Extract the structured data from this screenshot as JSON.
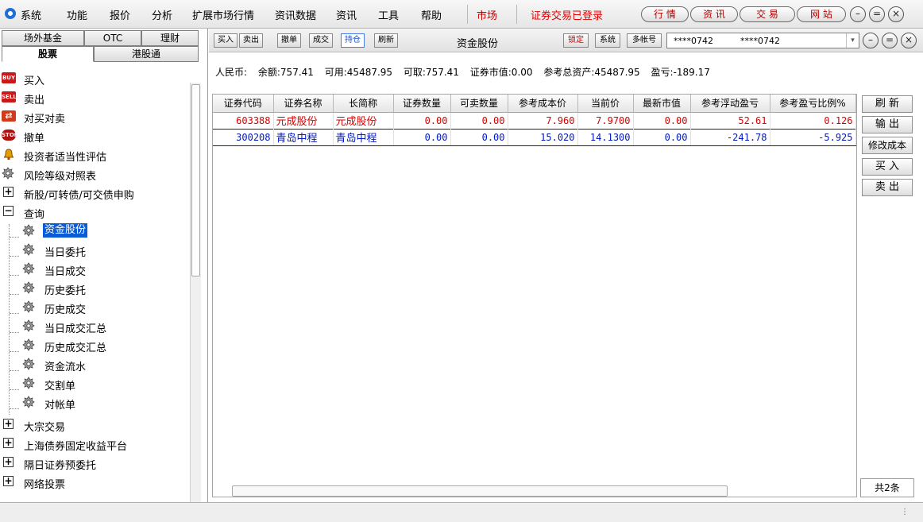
{
  "menu": {
    "items": [
      "系统",
      "功能",
      "报价",
      "分析",
      "扩展市场行情",
      "资讯数据",
      "资讯",
      "工具",
      "帮助"
    ],
    "market": "市场",
    "login_status": "证券交易已登录",
    "pills": [
      "行 情",
      "资 讯",
      "交 易",
      "网 站"
    ],
    "window_controls": [
      "–",
      "=",
      "×"
    ]
  },
  "left": {
    "tabs_row1": [
      "场外基金",
      "OTC",
      "理财"
    ],
    "tabs_row2": [
      "股票",
      "港股通"
    ],
    "tree": [
      {
        "label": "买入",
        "icon": "buy-badge-icon",
        "badge": "BUY"
      },
      {
        "label": "卖出",
        "icon": "sell-badge-icon",
        "badge": "SELL"
      },
      {
        "label": "对买对卖",
        "icon": "swap-icon",
        "badge": "⇄"
      },
      {
        "label": "撤单",
        "icon": "stop-hand-icon",
        "badge": "STOP"
      },
      {
        "label": "投资者适当性评估",
        "icon": "bell-icon"
      },
      {
        "label": "风险等级对照表",
        "icon": "gear-icon"
      },
      {
        "label": "新股/可转债/可交债申购",
        "icon": "plus-box-icon"
      },
      {
        "label": "查询",
        "icon": "minus-box-icon"
      },
      {
        "label": "资金股份",
        "icon": "gear-icon",
        "selected": true
      },
      {
        "label": "当日委托",
        "icon": "gear-icon"
      },
      {
        "label": "当日成交",
        "icon": "gear-icon"
      },
      {
        "label": "历史委托",
        "icon": "gear-icon"
      },
      {
        "label": "历史成交",
        "icon": "gear-icon"
      },
      {
        "label": "当日成交汇总",
        "icon": "gear-icon"
      },
      {
        "label": "历史成交汇总",
        "icon": "gear-icon"
      },
      {
        "label": "资金流水",
        "icon": "gear-icon"
      },
      {
        "label": "交割单",
        "icon": "gear-icon"
      },
      {
        "label": "对帐单",
        "icon": "gear-icon"
      },
      {
        "label": "大宗交易",
        "icon": "plus-box-icon"
      },
      {
        "label": "上海债券固定收益平台",
        "icon": "plus-box-icon"
      },
      {
        "label": "隔日证券预委托",
        "icon": "plus-box-icon"
      },
      {
        "label": "网络投票",
        "icon": "plus-box-icon"
      }
    ]
  },
  "toolbar": {
    "buttons": [
      "买入",
      "卖出",
      "撤单",
      "成交",
      "持仓",
      "刷新"
    ],
    "active_button": "持仓",
    "title": "资金股份",
    "lock": "锁定",
    "system": "系统",
    "multi_account": "多帐号",
    "account_1": "****0742",
    "account_2": "****0742",
    "dropdown_arrow": "▾"
  },
  "summary": {
    "currency": "人民币:",
    "balance": "余额:757.41",
    "available": "可用:45487.95",
    "withdrawable": "可取:757.41",
    "market_value": "证券市值:0.00",
    "total_assets": "参考总资产:45487.95",
    "pnl": "盈亏:-189.17"
  },
  "table": {
    "headers": [
      "证券代码",
      "证券名称",
      "长简称",
      "证券数量",
      "可卖数量",
      "参考成本价",
      "当前价",
      "最新市值",
      "参考浮动盈亏",
      "参考盈亏比例%"
    ],
    "rows": [
      {
        "trend": "up",
        "cells": [
          "603388",
          "元成股份",
          "元成股份",
          "0.00",
          "0.00",
          "7.960",
          "7.9700",
          "0.00",
          "52.61",
          "0.126"
        ]
      },
      {
        "trend": "down",
        "cells": [
          "300208",
          "青岛中程",
          "青岛中程",
          "0.00",
          "0.00",
          "15.020",
          "14.1300",
          "0.00",
          "-241.78",
          "-5.925"
        ]
      }
    ]
  },
  "side_buttons": [
    "刷 新",
    "输 出",
    "修改成本",
    "买 入",
    "卖 出"
  ],
  "count": "共2条",
  "colors": {
    "up": "#d80000",
    "down": "#0018c0",
    "selection": "#0a5cd6",
    "login": "#e00000"
  }
}
